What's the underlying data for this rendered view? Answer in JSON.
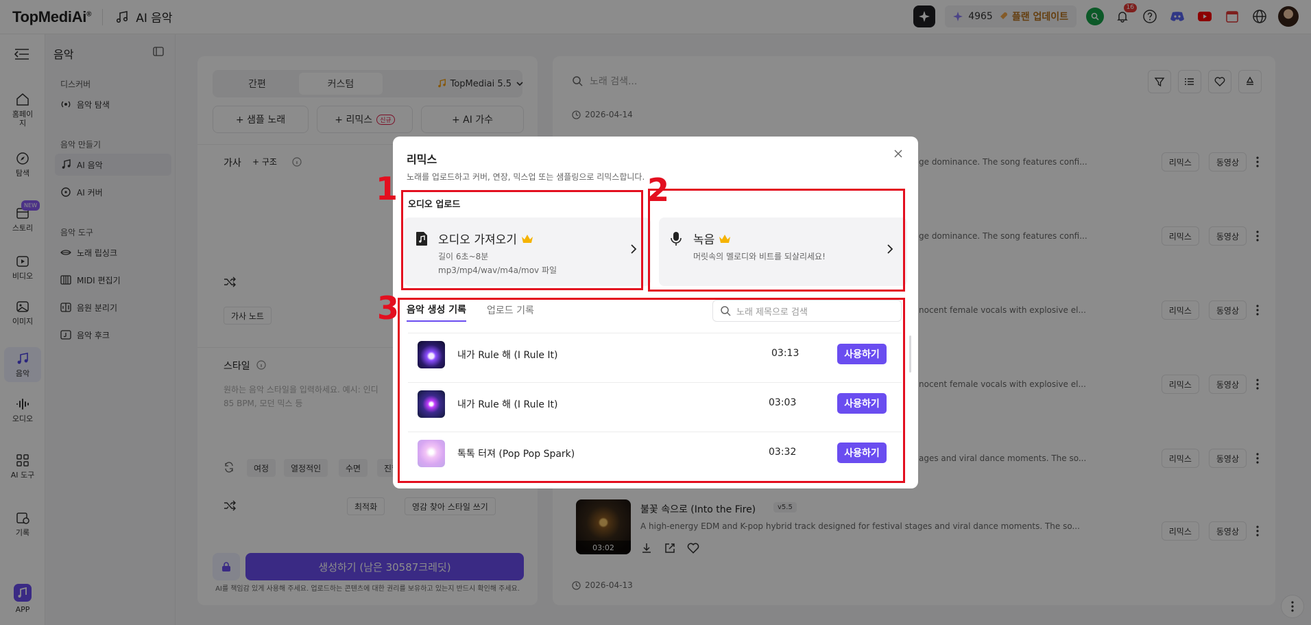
{
  "topbar": {
    "logo": "TopMediAi",
    "logo_mark": "®",
    "section_title": "AI 음악",
    "credits": "4965",
    "upgrade_label": "플랜 업데이트",
    "notification_count": "16"
  },
  "rail": {
    "items": [
      {
        "label": "홈페이지",
        "icon": "home-icon"
      },
      {
        "label": "탐색",
        "icon": "compass-icon"
      },
      {
        "label": "스토리",
        "icon": "story-icon",
        "badge": "NEW"
      },
      {
        "label": "비디오",
        "icon": "video-icon"
      },
      {
        "label": "이미지",
        "icon": "image-icon"
      },
      {
        "label": "음악",
        "icon": "music-icon"
      },
      {
        "label": "오디오",
        "icon": "audio-icon"
      },
      {
        "label": "AI 도구",
        "icon": "tools-icon"
      },
      {
        "label": "기록",
        "icon": "history-icon"
      },
      {
        "label": "APP",
        "icon": "app-icon"
      }
    ]
  },
  "subnav": {
    "title": "음악",
    "groups": [
      {
        "label": "디스커버",
        "items": [
          "음악 탐색"
        ]
      },
      {
        "label": "음악 만들기",
        "items": [
          "AI 음악",
          "AI 커버"
        ]
      },
      {
        "label": "음악 도구",
        "items": [
          "노래 립싱크",
          "MIDI 편집기",
          "음원 분리기",
          "음악 후크"
        ]
      }
    ]
  },
  "left_panel": {
    "mode_tabs": [
      "간편",
      "커스텀"
    ],
    "model": "TopMediai 5.5",
    "sample_button": "+ 샘플 노래",
    "remix_button": "+ 리믹스",
    "remix_badge": "신규",
    "ai_singer_button": "+ AI 가수",
    "lyrics_label": "가사",
    "structure_button": "+ 구조",
    "lyrics_note_button": "가사 노트",
    "style_label": "스타일",
    "style_placeholder_1": "원하는 음악 스타일을 입력하세요. 예시: 인디",
    "style_placeholder_2": "85 BPM, 모던 믹스 등",
    "style_tags": [
      "여정",
      "열정적인",
      "수면",
      "진할"
    ],
    "optimize_button": "최적화",
    "inspire_button": "영감 찾아 스타일 쓰기",
    "generate_button": "생성하기 (남은 30587크레딧)",
    "disclaimer": "AI를 책임감 있게 사용해 주세요. 업로드하는 콘텐츠에 대한 권리를 보유하고 있는지 반드시 확인해 주세요."
  },
  "right_panel": {
    "search_placeholder": "노래 검색...",
    "dates": [
      "2026-04-14",
      "2026-04-13"
    ],
    "rows": [
      {
        "desc": "ge dominance. The song features confi..."
      },
      {
        "desc": "ge dominance. The song features confi..."
      },
      {
        "desc": "nocent female vocals with explosive el..."
      },
      {
        "desc": "nocent female vocals with explosive el..."
      },
      {
        "desc": "ages and viral dance moments. The so..."
      }
    ],
    "remix_label": "리믹스",
    "video_label": "동영상",
    "featured_song": {
      "title": "불꽃 속으로 (Into the Fire)",
      "version": "v5.5",
      "desc": "A high-energy EDM and K-pop hybrid track designed for festival stages and viral dance moments. The so...",
      "duration": "03:02"
    }
  },
  "modal": {
    "title": "리믹스",
    "subtitle": "노래를 업로드하고 커버, 연장, 믹스업 또는 샘플링으로 리믹스합니다.",
    "upload_section": "오디오 업로드",
    "import_card": {
      "title": "오디오 가져오기",
      "line1": "길이 6초~8분",
      "line2": "mp3/mp4/wav/m4a/mov 파일"
    },
    "record_card": {
      "title": "녹음",
      "line1": "머릿속의 멜로디와 비트를 되살리세요!"
    },
    "tabs": [
      "음악 생성 기록",
      "업로드 기록"
    ],
    "search_placeholder": "노래 제목으로 검색",
    "use_label": "사용하기",
    "items": [
      {
        "title": "내가 Rule 해 (I Rule It)",
        "duration": "03:13"
      },
      {
        "title": "내가 Rule 해 (I Rule It)",
        "duration": "03:03"
      },
      {
        "title": "톡톡 터져 (Pop Pop Spark)",
        "duration": "03:32"
      }
    ]
  },
  "annotations": [
    "1",
    "2",
    "3"
  ],
  "colors": {
    "accent": "#6a4df0",
    "annotation": "#e30f1f"
  }
}
